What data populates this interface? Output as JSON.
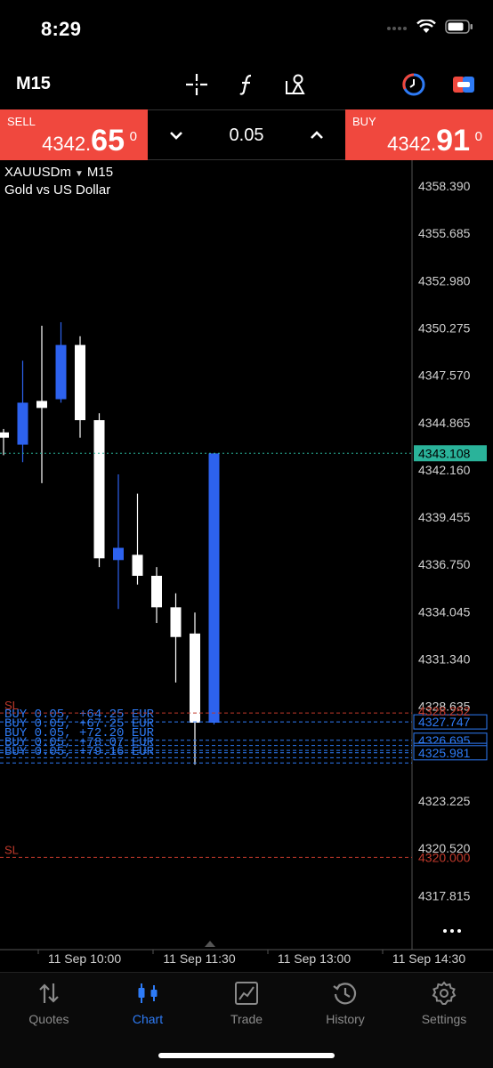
{
  "status_bar": {
    "time": "8:29"
  },
  "toolbar": {
    "timeframe": "M15"
  },
  "trade_panel": {
    "sell_label": "SELL",
    "sell_price_small": "4342.",
    "sell_price_big": "65",
    "sell_price_sup": "0",
    "buy_label": "BUY",
    "buy_price_small": "4342.",
    "buy_price_big": "91",
    "buy_price_sup": "0",
    "volume": "0.05"
  },
  "symbol": {
    "name": "XAUUSDm",
    "timeframe": "M15",
    "description": "Gold vs US Dollar"
  },
  "chart_data": {
    "type": "candlestick",
    "y_ticks": [
      "4358.390",
      "4355.685",
      "4352.980",
      "4350.275",
      "4347.570",
      "4344.865",
      "4342.160",
      "4339.455",
      "4336.750",
      "4334.045",
      "4331.340",
      "4328.635",
      "4323.225",
      "4320.520",
      "4317.815"
    ],
    "ylim": [
      4315.7,
      4359.6
    ],
    "x_ticks": [
      "11 Sep 10:00",
      "11 Sep 11:30",
      "11 Sep 13:00",
      "11 Sep 14:30"
    ],
    "candles": [
      {
        "o": 4344.0,
        "h": 4344.5,
        "l": 4343.0,
        "c": 4344.3,
        "dir": "up"
      },
      {
        "o": 4343.6,
        "h": 4348.4,
        "l": 4342.6,
        "c": 4346.0,
        "dir": "down"
      },
      {
        "o": 4345.7,
        "h": 4350.4,
        "l": 4341.4,
        "c": 4346.1,
        "dir": "up"
      },
      {
        "o": 4346.2,
        "h": 4350.6,
        "l": 4346.0,
        "c": 4349.3,
        "dir": "down"
      },
      {
        "o": 4349.3,
        "h": 4349.8,
        "l": 4344.0,
        "c": 4345.0,
        "dir": "up"
      },
      {
        "o": 4345.0,
        "h": 4345.4,
        "l": 4336.6,
        "c": 4337.1,
        "dir": "up"
      },
      {
        "o": 4337.7,
        "h": 4341.9,
        "l": 4334.2,
        "c": 4337.0,
        "dir": "down"
      },
      {
        "o": 4337.3,
        "h": 4340.8,
        "l": 4335.6,
        "c": 4336.1,
        "dir": "up"
      },
      {
        "o": 4336.1,
        "h": 4336.6,
        "l": 4333.4,
        "c": 4334.3,
        "dir": "up"
      },
      {
        "o": 4334.3,
        "h": 4335.1,
        "l": 4330.0,
        "c": 4332.6,
        "dir": "up"
      },
      {
        "o": 4332.8,
        "h": 4334.0,
        "l": 4325.3,
        "c": 4327.7,
        "dir": "up"
      },
      {
        "o": 4327.7,
        "h": 4343.1,
        "l": 4327.6,
        "c": 4343.1,
        "dir": "down"
      }
    ],
    "current_price": "4343.108",
    "sl_label": "SL",
    "sl_price": "4320.000",
    "sl_upper_label": "SL",
    "sl_upper_price": "4328.252",
    "position_levels": [
      "4327.747",
      "4326.695",
      "4326.118",
      "4325.981"
    ],
    "position_labels": [
      "BUY 0.05, +64.25 EUR",
      "BUY 0.05, +67.25 EUR",
      "BUY 0.05, +72.20 EUR",
      "BUY 0.05, +78.07 EUR",
      "BUY 0.05, +79.16 EUR"
    ],
    "colors": {
      "up": "#ffffff",
      "down": "#2d62ee",
      "grid_line": "#2f2f2f",
      "current": "#2ab39a",
      "sl": "#c0392b",
      "position": "#2e7bf6"
    }
  },
  "tabs": [
    {
      "label": "Quotes",
      "icon": "quotes-icon"
    },
    {
      "label": "Chart",
      "icon": "chart-icon"
    },
    {
      "label": "Trade",
      "icon": "trade-icon"
    },
    {
      "label": "History",
      "icon": "history-icon"
    },
    {
      "label": "Settings",
      "icon": "settings-icon"
    }
  ]
}
